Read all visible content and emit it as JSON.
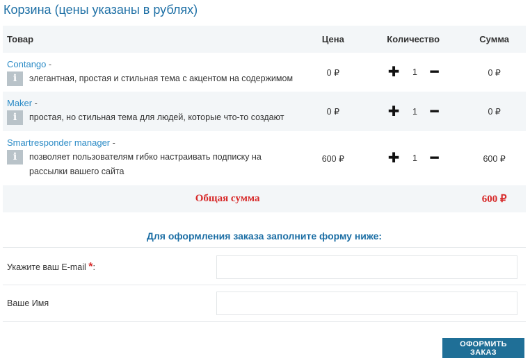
{
  "title": "Корзина (цены указаны в рублях)",
  "table": {
    "headers": {
      "product": "Товар",
      "price": "Цена",
      "quantity": "Количество",
      "sum": "Сумма"
    },
    "rows": [
      {
        "name": "Contango",
        "dash": " -",
        "description": "элегантная, простая и стильная тема с акцентом на содержимом",
        "price": "0 ₽",
        "quantity": "1",
        "sum": "0 ₽"
      },
      {
        "name": "Maker",
        "dash": " -",
        "description": "простая, но стильная тема для людей, которые что-то создают",
        "price": "0 ₽",
        "quantity": "1",
        "sum": "0 ₽"
      },
      {
        "name": "Smartresponder manager",
        "dash": " -",
        "description": "позволяет пользователям гибко настраивать подписку на рассылки вашего сайта",
        "price": "600 ₽",
        "quantity": "1",
        "sum": "600 ₽"
      }
    ],
    "info_glyph": "i",
    "plus_glyph": "✚",
    "minus_glyph": "━",
    "total_label": "Общая сумма",
    "total_value": "600 ₽"
  },
  "form": {
    "heading": "Для оформления заказа заполните форму ниже:",
    "email_label": "Укажите ваш E-mail",
    "required_mark": "*",
    "email_suffix": ":",
    "email_value": "",
    "name_label": "Ваше Имя",
    "name_value": "",
    "submit_label": "ОФОРМИТЬ ЗАКАЗ"
  },
  "colors": {
    "accent": "#1d6fa5",
    "link": "#2b8bc6",
    "total": "#d72a2a",
    "button": "#1f6f97",
    "row_alt": "#f3f6f8"
  },
  "icons": {
    "info": "info-icon",
    "plus": "plus-icon",
    "minus": "minus-icon"
  }
}
